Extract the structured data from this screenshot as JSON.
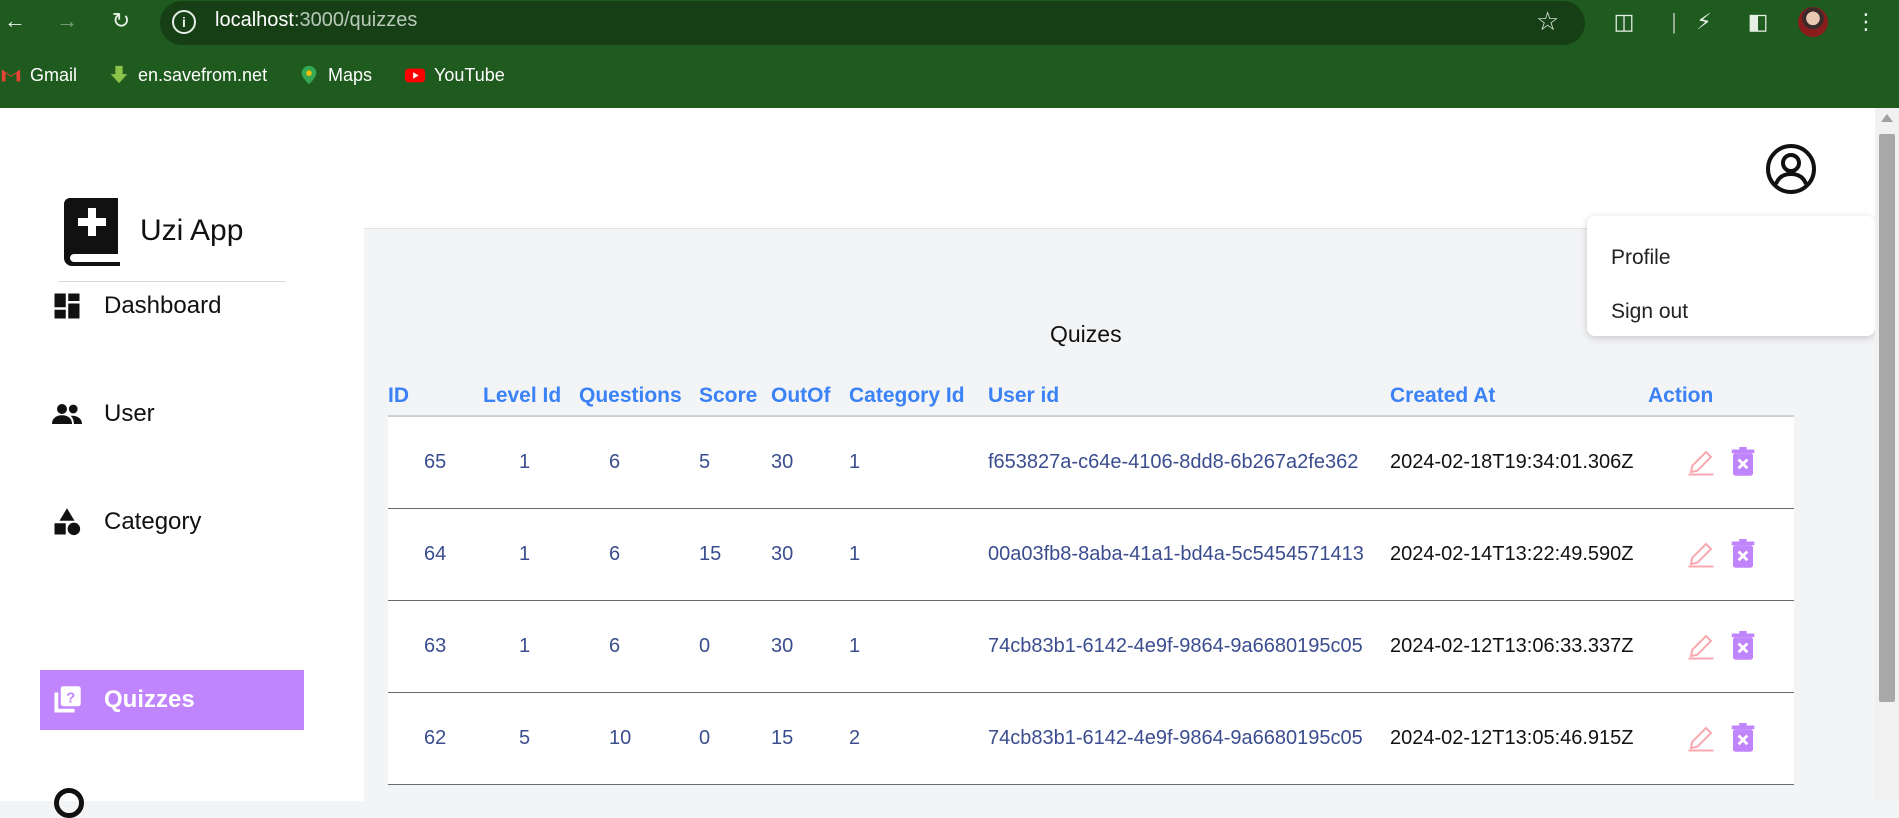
{
  "browser": {
    "url_host": "localhost",
    "url_path": ":3000/quizzes",
    "bookmarks": [
      {
        "label": "Gmail",
        "icon": "gmail-icon"
      },
      {
        "label": "en.savefrom.net",
        "icon": "download-arrow-icon"
      },
      {
        "label": "Maps",
        "icon": "maps-pin-icon"
      },
      {
        "label": "YouTube",
        "icon": "youtube-icon"
      }
    ]
  },
  "sidebar": {
    "brand": "Uzi App",
    "items": [
      {
        "label": "Dashboard",
        "icon": "dashboard-icon",
        "active": false
      },
      {
        "label": "User",
        "icon": "users-icon",
        "active": false
      },
      {
        "label": "Category",
        "icon": "shapes-icon",
        "active": false
      },
      {
        "label": "Quizzes",
        "icon": "quiz-icon",
        "active": true
      }
    ]
  },
  "main": {
    "title": "Quizes",
    "columns": [
      "ID",
      "Level Id",
      "Questions",
      "Score",
      "OutOf",
      "Category Id",
      "User id",
      "Created At",
      "Action"
    ],
    "rows": [
      {
        "id": "65",
        "level": "1",
        "questions": "6",
        "score": "5",
        "outof": "30",
        "category": "1",
        "user": "f653827a-c64e-4106-8dd8-6b267a2fe362",
        "created": "2024-02-18T19:34:01.306Z"
      },
      {
        "id": "64",
        "level": "1",
        "questions": "6",
        "score": "15",
        "outof": "30",
        "category": "1",
        "user": "00a03fb8-8aba-41a1-bd4a-5c5454571413",
        "created": "2024-02-14T13:22:49.590Z"
      },
      {
        "id": "63",
        "level": "1",
        "questions": "6",
        "score": "0",
        "outof": "30",
        "category": "1",
        "user": "74cb83b1-6142-4e9f-9864-9a6680195c05",
        "created": "2024-02-12T13:06:33.337Z"
      },
      {
        "id": "62",
        "level": "5",
        "questions": "10",
        "score": "0",
        "outof": "15",
        "category": "2",
        "user": "74cb83b1-6142-4e9f-9864-9a6680195c05",
        "created": "2024-02-12T13:05:46.915Z"
      }
    ]
  },
  "user_menu": {
    "items": [
      "Profile",
      "Sign out"
    ]
  },
  "colors": {
    "browser_frame": "#1f5a1f",
    "accent": "#c084fc",
    "header_text": "#3b82f6",
    "cell_text": "#3b4d8f",
    "edit_icon": "#f9a8b0",
    "delete_icon": "#c084fc"
  }
}
